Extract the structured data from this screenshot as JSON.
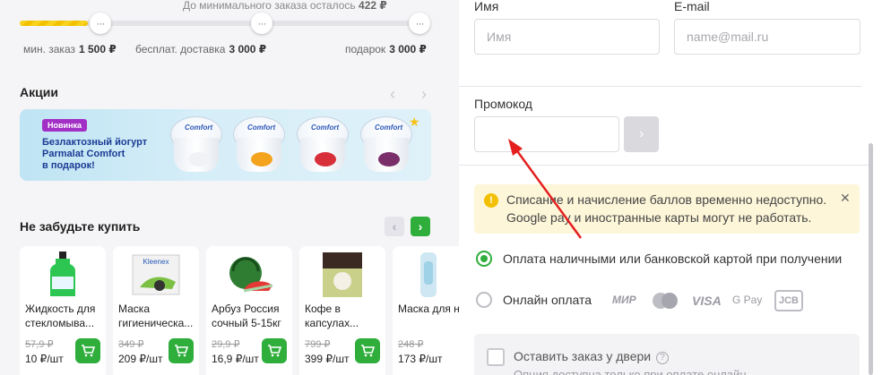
{
  "progress": {
    "remaining_text": "До минимального заказа осталось",
    "remaining_amount": "422 ₽",
    "fill_fraction": 0.17,
    "knob_glyph": "···",
    "milestones": [
      {
        "label": "мин. заказ",
        "value": "1 500 ₽"
      },
      {
        "label": "бесплат. доставка",
        "value": "3 000 ₽"
      },
      {
        "label": "подарок",
        "value": "3 000 ₽"
      }
    ]
  },
  "promos": {
    "title": "Акции",
    "prev_icon": "‹",
    "next_icon": "›",
    "banner": {
      "badge": "Новинка",
      "line1": "Безлактозный йогурт",
      "line2": "Parmalat Comfort",
      "line3": "в подарок!",
      "brand": "Comfort"
    }
  },
  "dont_forget": {
    "title": "Не забудьте купить",
    "prev_icon": "‹",
    "next_icon": "›",
    "products": [
      {
        "name": "Жидкость для стекломыва...",
        "old_price": "57,9 ₽",
        "price": "10 ₽/шт"
      },
      {
        "name": "Маска гигиеническа...",
        "old_price": "349 ₽",
        "price": "209 ₽/шт"
      },
      {
        "name": "Арбуз Россия сочный 5-15кг",
        "old_price": "29,9 ₽",
        "price": "16,9 ₽/шт"
      },
      {
        "name": "Кофе в капсулах...",
        "old_price": "799 ₽",
        "price": "399 ₽/шт"
      },
      {
        "name": "Маска для но",
        "old_price": "248 ₽",
        "price": "173 ₽/шт"
      }
    ],
    "product_thumb_labels": [
      "",
      "Kleenex",
      "",
      "",
      ""
    ]
  },
  "form": {
    "name_label": "Имя",
    "name_placeholder": "Имя",
    "email_label": "E-mail",
    "email_placeholder": "name@mail.ru",
    "promo_label": "Промокод",
    "promo_value": "",
    "promo_submit_icon": "›"
  },
  "notice": {
    "icon": "!",
    "text": "Списание и начисление баллов временно недоступно. Google pay и иностранные карты могут не работать.",
    "close": "✕"
  },
  "payment": {
    "options": [
      {
        "label": "Оплата наличными или банковской картой при получении",
        "selected": true
      },
      {
        "label": "Онлайн оплата",
        "selected": false
      }
    ],
    "logos": [
      "МИР",
      "mastercard",
      "VISA",
      "G Pay",
      "JCB"
    ]
  },
  "door": {
    "label": "Оставить заказ у двери",
    "help": "?",
    "sub": "Опция доступна только при оплате онлайн"
  },
  "colors": {
    "accent_green": "#2fae3c",
    "progress_yellow": "#f7d21c",
    "notice_bg": "#fdf6d9",
    "annotation_red": "#e41e1e"
  }
}
